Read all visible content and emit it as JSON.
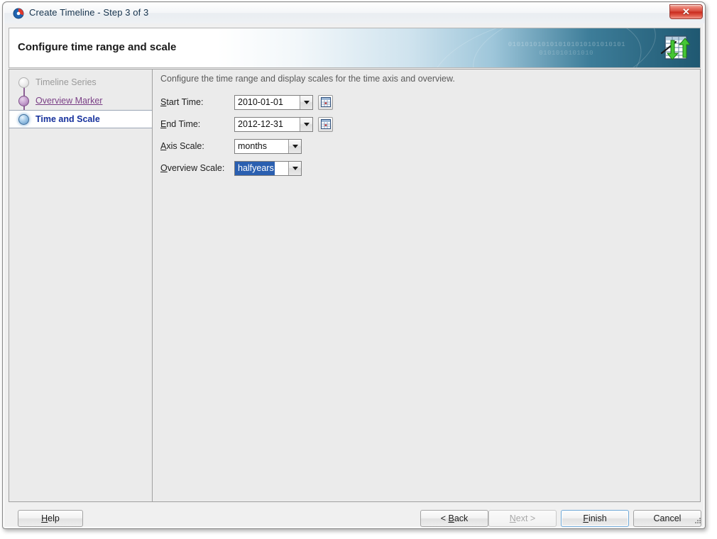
{
  "window": {
    "title": "Create Timeline - Step 3 of 3",
    "app_icon": "oracle-circle-icon",
    "close_label": "✕"
  },
  "banner": {
    "heading": "Configure time range and scale",
    "binary_line1": "0101010101010101010101010101",
    "binary_line2": "0101010101010",
    "icon": "timeline-sync-icon"
  },
  "sidebar": {
    "steps": [
      {
        "label": "Timeline Series",
        "state": "inactive",
        "marker": "step-dot-inactive"
      },
      {
        "label": "Overview Marker",
        "state": "visited",
        "marker": "step-dot-visited"
      },
      {
        "label": "Time and Scale",
        "state": "current",
        "marker": "step-dot-current"
      }
    ]
  },
  "content": {
    "description": "Configure the time range and display scales for the time axis and overview.",
    "fields": [
      {
        "label_prefix": "S",
        "label_rest": "tart Time:",
        "value": "2010-01-01",
        "has_calendar": true,
        "selected": false
      },
      {
        "label_prefix": "E",
        "label_rest": "nd Time:",
        "value": "2012-12-31",
        "has_calendar": true,
        "selected": false
      },
      {
        "label_prefix": "A",
        "label_rest": "xis Scale:",
        "value": "months",
        "has_calendar": false,
        "selected": false
      },
      {
        "label_prefix": "O",
        "label_rest": "verview Scale:",
        "value": "halfyears",
        "has_calendar": false,
        "selected": true
      }
    ]
  },
  "footer": {
    "help": {
      "prefix": "H",
      "rest": "elp"
    },
    "back": {
      "prefix": "",
      "rest": "< Back",
      "accel": "B"
    },
    "next": {
      "prefix": "",
      "rest": "Next >",
      "accel": "N",
      "disabled": true
    },
    "finish": {
      "prefix": "F",
      "rest": "inish",
      "focused": true
    },
    "cancel": {
      "prefix": "",
      "rest": "Cancel"
    }
  },
  "colors": {
    "selection_blue": "#2a5fb0",
    "current_step_text": "#15309c",
    "visited_step_text": "#7a3f86",
    "banner_gradient_end": "#1f5871",
    "close_button_red": "#c8291c",
    "focus_ring": "#6fa8d6"
  }
}
